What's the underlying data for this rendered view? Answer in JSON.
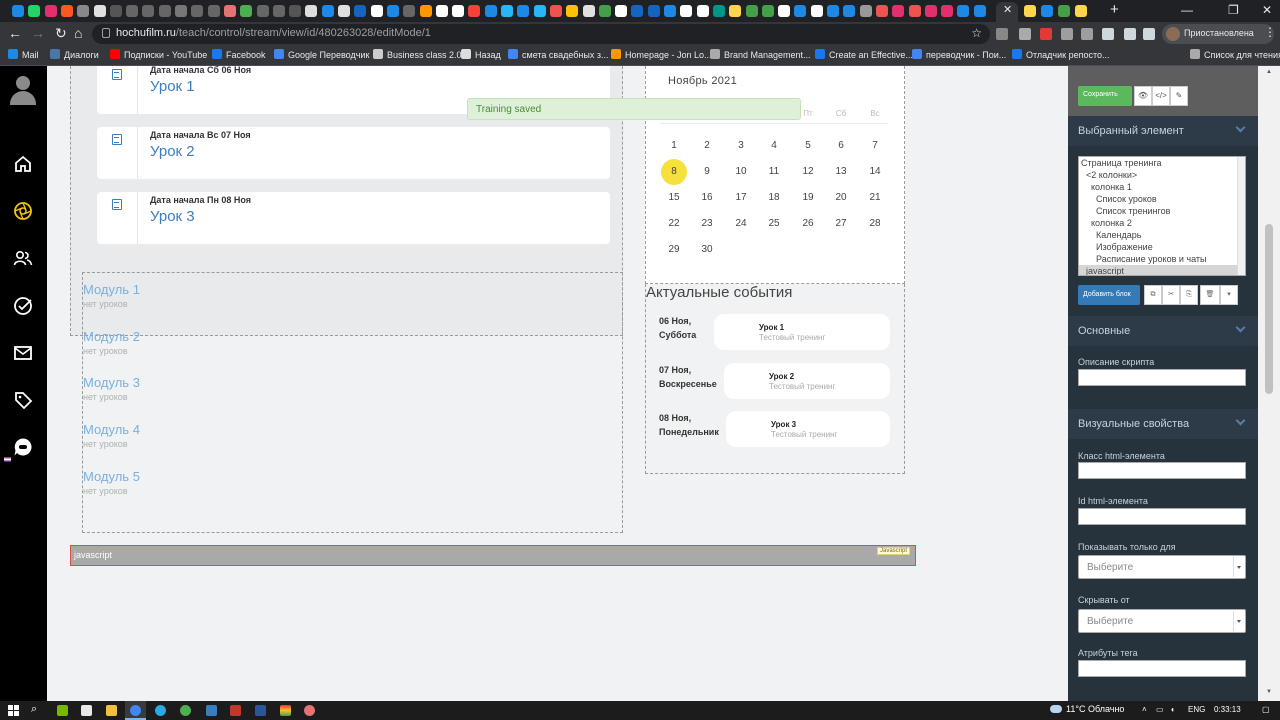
{
  "browser": {
    "url_host": "hochufilm.ru",
    "url_path": "/teach/control/stream/view/id/480263028/editMode/1",
    "profile_label": "Приостановлена",
    "tab_colors": [
      "#1e88e5",
      "#25d366",
      "#e1306c",
      "#ff5722",
      "#888",
      "#e0e0e0",
      "#555",
      "#666",
      "#666",
      "#666",
      "#777",
      "#666",
      "#666",
      "#e57373",
      "#4caf50",
      "#666",
      "#666",
      "#555",
      "#ddd",
      "#1e88e5",
      "#e0e0e0",
      "#1565c0",
      "#fff",
      "#1e88e5",
      "#666",
      "#ff9800",
      "#ffffff",
      "#ffffff",
      "#f44336",
      "#1e88e5",
      "#29b6f6",
      "#1e88e5",
      "#29b6f6",
      "#ef5350",
      "#ffc107",
      "#e0e0e0",
      "#43a047",
      "#ffffff",
      "#1565c0",
      "#1565c0",
      "#1e88e5",
      "#ffffff",
      "#ffffff",
      "#009688",
      "#ffd54f",
      "#43a047",
      "#43a047",
      "#ffffff",
      "#1e88e5",
      "#ffffff",
      "#1e88e5",
      "#1e88e5",
      "#999",
      "#ef5350",
      "#e1306c",
      "#ef5350",
      "#e1306c",
      "#e1306c",
      "#1e88e5",
      "#1e88e5"
    ]
  },
  "bookmarks": [
    {
      "label": "Mail",
      "color": "#1e88e5"
    },
    {
      "label": "Диалоги",
      "color": "#4a76a8"
    },
    {
      "label": "Подписки - YouTube",
      "color": "#f00"
    },
    {
      "label": "Facebook",
      "color": "#1877f2"
    },
    {
      "label": "Google Переводчик",
      "color": "#4285f4"
    },
    {
      "label": "Business class 2.0",
      "color": "#ccc"
    },
    {
      "label": "Назад",
      "color": "#ddd"
    },
    {
      "label": "смета свадебных з...",
      "color": "#4285f4"
    },
    {
      "label": "Homepage - Jon Lo...",
      "color": "#ff9800"
    },
    {
      "label": "Brand Management...",
      "color": "#aaa"
    },
    {
      "label": "Create an Effective...",
      "color": "#1877f2"
    },
    {
      "label": "переводчик - Пои...",
      "color": "#4285f4"
    },
    {
      "label": "Отладчик репосто...",
      "color": "#1877f2"
    },
    {
      "label": "Список для чтения",
      "color": "#aaa"
    }
  ],
  "lessons": [
    {
      "date": "Дата начала Сб 06 Ноя",
      "title": "Урок 1"
    },
    {
      "date": "Дата начала Вс 07 Ноя",
      "title": "Урок 2"
    },
    {
      "date": "Дата начала Пн 08 Ноя",
      "title": "Урок 3"
    }
  ],
  "toast": "Training saved",
  "modules": [
    {
      "title": "Модуль 1",
      "sub": "нет уроков"
    },
    {
      "title": "Модуль 2",
      "sub": "нет уроков"
    },
    {
      "title": "Модуль 3",
      "sub": "нет уроков"
    },
    {
      "title": "Модуль 4",
      "sub": "нет уроков"
    },
    {
      "title": "Модуль 5",
      "sub": "нет уроков"
    }
  ],
  "calendar": {
    "title": "Ноябрь  2021",
    "weekdays": [
      "Пт",
      "Сб",
      "Вс"
    ],
    "today": "8",
    "weeks": [
      [
        "1",
        "2",
        "3",
        "4",
        "5",
        "6",
        "7"
      ],
      [
        "8",
        "9",
        "10",
        "11",
        "12",
        "13",
        "14"
      ],
      [
        "15",
        "16",
        "17",
        "18",
        "19",
        "20",
        "21"
      ],
      [
        "22",
        "23",
        "24",
        "25",
        "26",
        "27",
        "28"
      ],
      [
        "29",
        "30"
      ]
    ]
  },
  "events": {
    "title": "Актуальные события",
    "items": [
      {
        "date": "06 Ноя, Суббота",
        "name": "Урок 1",
        "sub": "Тестовый тренинг"
      },
      {
        "date": "07 Ноя, Воскресенье",
        "name": "Урок 2",
        "sub": "Тестовый тренинг"
      },
      {
        "date": "08 Ноя, Понедельник",
        "name": "Урок 3",
        "sub": "Тестовый тренинг"
      }
    ]
  },
  "js_block": {
    "label": "javascript",
    "tag": "Javascript"
  },
  "panel": {
    "save": "Сохранить",
    "selected_title": "Выбранный элемент",
    "tree": [
      {
        "label": "Страница тренинга",
        "level": 0
      },
      {
        "label": "<2 колонки>",
        "level": 1
      },
      {
        "label": "колонка 1",
        "level": 2
      },
      {
        "label": "Список уроков",
        "level": 3
      },
      {
        "label": "Список тренингов",
        "level": 3
      },
      {
        "label": "колонка 2",
        "level": 2
      },
      {
        "label": "Календарь",
        "level": 3
      },
      {
        "label": "Изображение",
        "level": 3
      },
      {
        "label": "Расписание уроков и чаты",
        "level": 3
      },
      {
        "label": "javascript",
        "level": 1,
        "selected": true
      }
    ],
    "add_block": "Добавить блок",
    "basic_title": "Основные",
    "script_desc": "Описание скрипта",
    "visual_title": "Визуальные свойства",
    "html_class": "Класс html-элемента",
    "html_id": "Id html-элемента",
    "show_only": "Показывать только для",
    "hide_from": "Скрывать от",
    "select_placeholder": "Выберите",
    "tag_attrs": "Атрибуты тега"
  },
  "taskbar": {
    "weather": "11°C  Облачно",
    "lang": "ENG",
    "time": "0:33:13"
  }
}
